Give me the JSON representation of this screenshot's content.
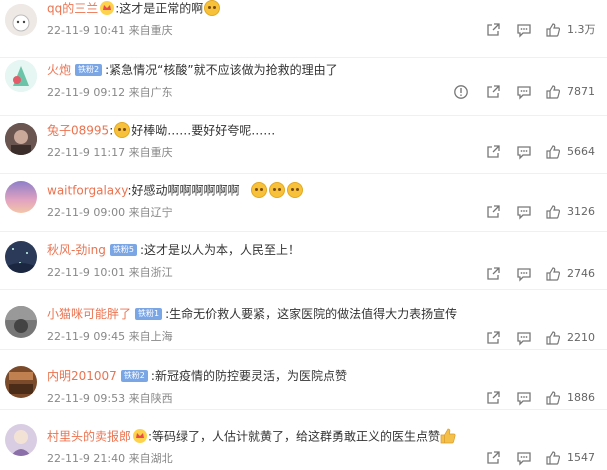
{
  "comments": [
    {
      "username": "qq的三兰",
      "badge": "",
      "text": ":这才是正常的啊",
      "time": "22-11-9 10:41",
      "location": "来自重庆",
      "likes": "1.3万",
      "avatar_color": "#e9e3e0",
      "has_report": false
    },
    {
      "username": "火炮",
      "badge": "铁粉2",
      "text": ":紧急情况“核酸”就不应该做为抢救的理由了",
      "time": "22-11-9 09:12",
      "location": "来自广东",
      "likes": "7871",
      "avatar_color": "#7fd0c0",
      "has_report": true
    },
    {
      "username": "兔子08995",
      "badge": "",
      "text": "好棒呦……要好好夸呢……",
      "time": "22-11-9 11:17",
      "location": "来自重庆",
      "likes": "5664",
      "avatar_color": "#5a4540",
      "has_report": false
    },
    {
      "username": "waitforgalaxy",
      "badge": "",
      "text": ":好感动啊啊啊啊啊啊",
      "time": "22-11-9 09:00",
      "location": "来自辽宁",
      "likes": "3126",
      "avatar_color": "#c89ac8",
      "has_report": false
    },
    {
      "username": "秋风-劲ing",
      "badge": "铁粉5",
      "text": ":这才是以人为本，人民至上！",
      "time": "22-11-9 10:01",
      "location": "来自浙江",
      "likes": "2746",
      "avatar_color": "#2c3e5c",
      "has_report": false
    },
    {
      "username": "小猫咪可能胖了",
      "badge": "铁粉1",
      "text": ":生命无价救人要紧，这家医院的做法值得大力表扬宣传",
      "time": "22-11-9 09:45",
      "location": "来自上海",
      "likes": "2210",
      "avatar_color": "#6b6b6b",
      "has_report": false
    },
    {
      "username": "内明201007",
      "badge": "铁粉2",
      "text": ":新冠疫情的防控要灵活，为医院点赞",
      "time": "22-11-9 09:53",
      "location": "来自陕西",
      "likes": "1886",
      "avatar_color": "#8a5a3a",
      "has_report": false
    },
    {
      "username": "村里头的卖报郎",
      "badge": "",
      "text": ":等码绿了，人估计就黄了，给这群勇敢正义的医生点赞",
      "time": "22-11-9 21:40",
      "location": "来自湖北",
      "likes": "1547",
      "avatar_color": "#c9b8d6",
      "has_report": false
    }
  ],
  "icons": {
    "report": "report-icon",
    "share": "share-icon",
    "reply": "comment-icon",
    "like": "thumbs-up-icon",
    "crown": "crown-icon",
    "emoji": "emoji-face-icon",
    "emoji_thumb": "thumbs-up-emoji-icon"
  }
}
